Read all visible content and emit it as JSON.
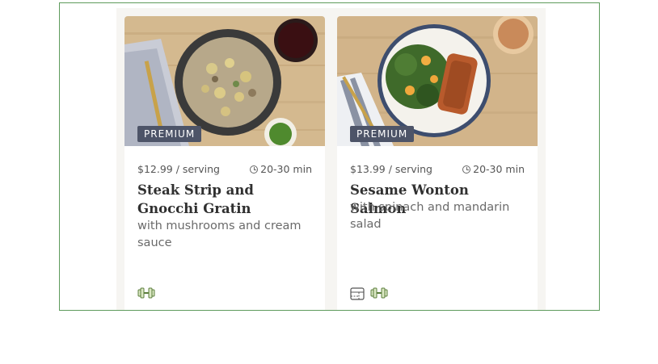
{
  "cards": [
    {
      "badge": "PREMIUM",
      "price": "$12.99 / serving",
      "time": "20-30 min",
      "title": "Steak Strip and Gnocchi Gratin",
      "subtitle": "with mushrooms and cream sauce",
      "tags": [
        "high-protein-icon"
      ]
    },
    {
      "badge": "PREMIUM",
      "price": "$13.99 / serving",
      "time": "20-30 min",
      "title": "Sesame Wonton Salmon",
      "subtitle": "with spinach and mandarin salad",
      "tags": [
        "calorie-smart-icon",
        "high-protein-icon"
      ]
    }
  ],
  "colors": {
    "frame_border": "#5e9b5c",
    "badge_bg": "#4d5468",
    "tag_icon": "#5a7d3a"
  }
}
